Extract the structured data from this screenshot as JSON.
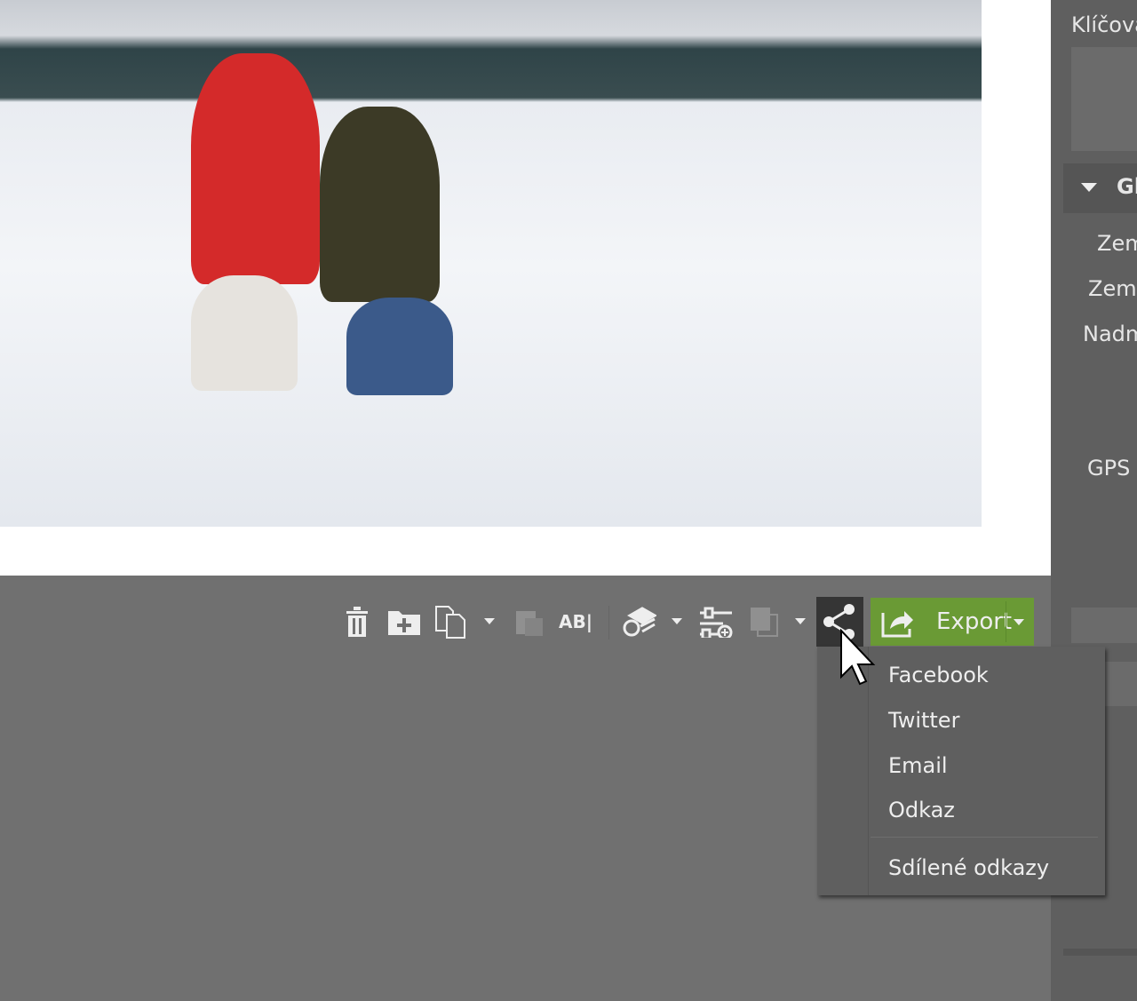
{
  "sidebar": {
    "keywords_label": "Klíčova",
    "section_title": "Gl",
    "labels": [
      "Zem",
      "Zeme",
      "Nadm",
      "GPS"
    ]
  },
  "toolbar": {
    "icons": [
      "trash-icon",
      "new-folder-icon",
      "copy-icon",
      "paste-icon",
      "rename-icon",
      "layers-icon",
      "adjustments-icon",
      "duplicate-icon",
      "share-icon"
    ],
    "export_label": "Export",
    "export_color": "#6a9a35"
  },
  "share_menu": {
    "items": [
      "Facebook",
      "Twitter",
      "Email",
      "Odkaz"
    ],
    "shared_links": "Sdílené odkazy"
  }
}
